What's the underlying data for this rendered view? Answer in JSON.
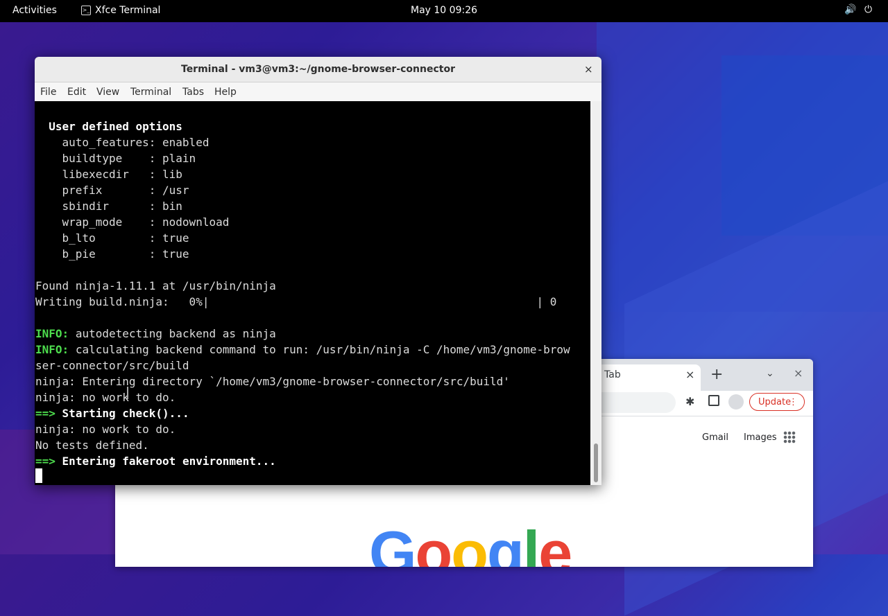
{
  "topbar": {
    "activities": "Activities",
    "app_name": "Xfce Terminal",
    "app_icon_glyph": ">_",
    "clock": "May 10  09:26",
    "volume_icon": "🔊",
    "power_icon": "⏻"
  },
  "terminal": {
    "title": "Terminal - vm3@vm3:~/gnome-browser-connector",
    "close_glyph": "×",
    "menu": [
      "File",
      "Edit",
      "View",
      "Terminal",
      "Tabs",
      "Help"
    ],
    "lines": [
      "",
      "  User defined options",
      "    auto_features: enabled",
      "    buildtype    : plain",
      "    libexecdir   : lib",
      "    prefix       : /usr",
      "    sbindir      : bin",
      "    wrap_mode    : nodownload",
      "    b_lto        : true",
      "    b_pie        : true",
      "",
      "Found ninja-1.11.1 at /usr/bin/ninja",
      "Writing build.ninja:   0%|                                                 | 0",
      "",
      "autodetecting backend as ninja",
      "calculating backend command to run: /usr/bin/ninja -C /home/vm3/gnome-brow",
      "ser-connector/src/build",
      "ninja: Entering directory `/home/vm3/gnome-browser-connector/src/build'",
      "ninja: no work to do.",
      "Starting check()...",
      "ninja: no work to do.",
      "No tests defined.",
      "Entering fakeroot environment..."
    ],
    "info_label": "INFO:",
    "arrow_label": "==>"
  },
  "chrome": {
    "tab_label": "Tab",
    "tab_close": "×",
    "new_tab": "+",
    "tab_dropdown": "⌄",
    "window_close": "×",
    "extensions_icon": "✱",
    "update_label": "Update",
    "update_dots": "⋮",
    "gmail": "Gmail",
    "images": "Images",
    "logo": "Google",
    "logo_colors": [
      "#4285f4",
      "#ea4335",
      "#fbbc05",
      "#4285f4",
      "#34a853",
      "#ea4335"
    ]
  }
}
